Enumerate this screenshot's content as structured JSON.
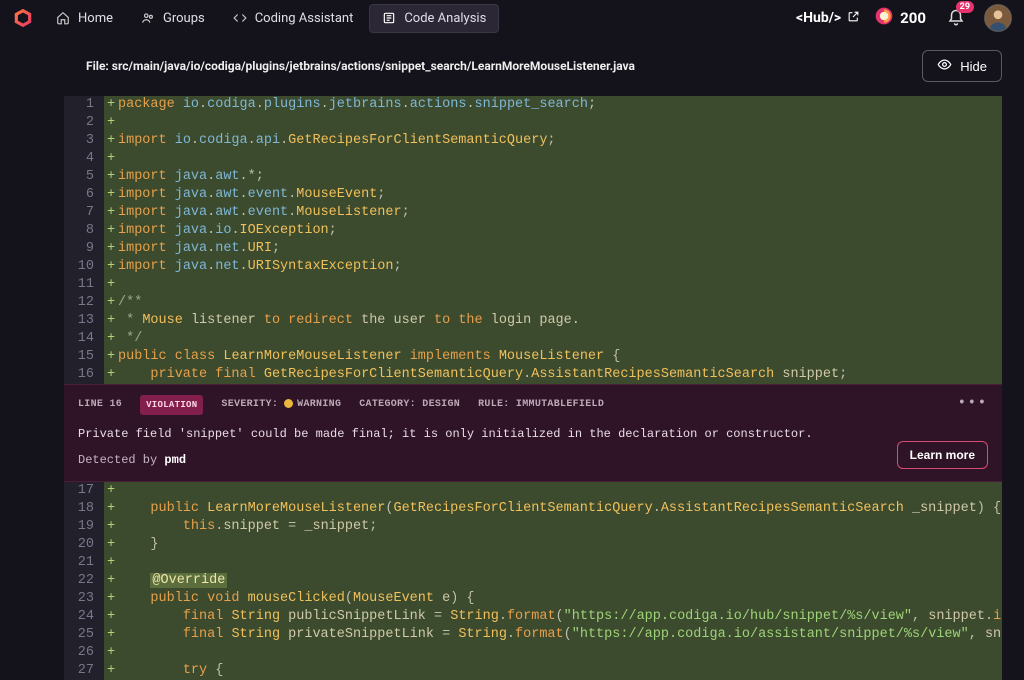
{
  "nav": {
    "home": "Home",
    "groups": "Groups",
    "assistant": "Coding Assistant",
    "analysis": "Code Analysis"
  },
  "hub_label": "<Hub/>",
  "points": "200",
  "notif_count": "29",
  "file": {
    "label": "File:",
    "path": "src/main/java/io/codiga/plugins/jetbrains/actions/snippet_search/LearnMoreMouseListener.java"
  },
  "hide_label": "Hide",
  "lines_a": [
    {
      "n": "1",
      "html": "<span class=t-kw>package</span> <span class=t-pkg>io</span><span class=t-punc>.</span><span class=t-pkg>codiga</span><span class=t-punc>.</span><span class=t-pkg>plugins</span><span class=t-punc>.</span><span class=t-pkg>jetbrains</span><span class=t-punc>.</span><span class=t-pkg>actions</span><span class=t-punc>.</span><span class=t-pkg>snippet_search</span><span class=t-punc>;</span>"
    },
    {
      "n": "2",
      "html": ""
    },
    {
      "n": "3",
      "html": "<span class=t-kw>import</span> <span class=t-pkg>io</span><span class=t-punc>.</span><span class=t-pkg>codiga</span><span class=t-punc>.</span><span class=t-pkg>api</span><span class=t-punc>.</span><span class=t-cls>GetRecipesForClientSemanticQuery</span><span class=t-punc>;</span>"
    },
    {
      "n": "4",
      "html": ""
    },
    {
      "n": "5",
      "html": "<span class=t-kw>import</span> <span class=t-pkg>java</span><span class=t-punc>.</span><span class=t-pkg>awt</span><span class=t-punc>.*;</span>"
    },
    {
      "n": "6",
      "html": "<span class=t-kw>import</span> <span class=t-pkg>java</span><span class=t-punc>.</span><span class=t-pkg>awt</span><span class=t-punc>.</span><span class=t-pkg>event</span><span class=t-punc>.</span><span class=t-cls>MouseEvent</span><span class=t-punc>;</span>"
    },
    {
      "n": "7",
      "html": "<span class=t-kw>import</span> <span class=t-pkg>java</span><span class=t-punc>.</span><span class=t-pkg>awt</span><span class=t-punc>.</span><span class=t-pkg>event</span><span class=t-punc>.</span><span class=t-cls>MouseListener</span><span class=t-punc>;</span>"
    },
    {
      "n": "8",
      "html": "<span class=t-kw>import</span> <span class=t-pkg>java</span><span class=t-punc>.</span><span class=t-pkg>io</span><span class=t-punc>.</span><span class=t-cls>IOException</span><span class=t-punc>;</span>"
    },
    {
      "n": "9",
      "html": "<span class=t-kw>import</span> <span class=t-pkg>java</span><span class=t-punc>.</span><span class=t-pkg>net</span><span class=t-punc>.</span><span class=t-cls>URI</span><span class=t-punc>;</span>"
    },
    {
      "n": "10",
      "html": "<span class=t-kw>import</span> <span class=t-pkg>java</span><span class=t-punc>.</span><span class=t-pkg>net</span><span class=t-punc>.</span><span class=t-cls>URISyntaxException</span><span class=t-punc>;</span>"
    },
    {
      "n": "11",
      "html": ""
    },
    {
      "n": "12",
      "html": "<span class=t-com>/**</span>"
    },
    {
      "n": "13",
      "html": "<span class=t-com> *</span> <span class=t-cls>Mouse</span> <span class=t-id>listener</span> <span class=t-kw>to</span> <span class=t-kw>redirect</span> <span class=t-id>the user</span> <span class=t-kw>to</span> <span class=t-kw>the</span> <span class=t-id>login page.</span>"
    },
    {
      "n": "14",
      "html": "<span class=t-com> */</span>"
    },
    {
      "n": "15",
      "html": "<span class=t-kw>public</span> <span class=t-kw>class</span> <span class=t-cls>LearnMoreMouseListener</span> <span class=t-kw>implements</span> <span class=t-cls>MouseListener</span> <span class=t-punc>{</span>"
    },
    {
      "n": "16",
      "html": "    <span class=t-kw>private</span> <span class=t-kw>final</span> <span class=t-cls>GetRecipesForClientSemanticQuery</span><span class=t-punc>.</span><span class=t-cls>AssistantRecipesSemanticSearch</span> <span class=t-id>snippet</span><span class=t-punc>;</span>"
    }
  ],
  "violation": {
    "line_label": "LINE 16",
    "pill": "VIOLATION",
    "severity_label": "SEVERITY:",
    "severity_value": "WARNING",
    "category_label": "CATEGORY:",
    "category_value": "DESIGN",
    "rule_label": "RULE:",
    "rule_value": "IMMUTABLEFIELD",
    "message": "Private field 'snippet' could be made final; it is only initialized in the declaration or constructor.",
    "detected_prefix": "Detected by ",
    "detected_tool": "pmd",
    "learn_more": "Learn more",
    "more": "•••"
  },
  "lines_b": [
    {
      "n": "17",
      "html": ""
    },
    {
      "n": "18",
      "html": "    <span class=t-kw>public</span> <span class=t-cls>LearnMoreMouseListener</span><span class=t-punc>(</span><span class=t-cls>GetRecipesForClientSemanticQuery</span><span class=t-punc>.</span><span class=t-cls>AssistantRecipesSemanticSearch</span> <span class=t-id>_snippet</span><span class=t-punc>) {</span>"
    },
    {
      "n": "19",
      "html": "        <span class=t-kw>this</span><span class=t-punc>.</span><span class=t-id>snippet</span> <span class=t-punc>=</span> <span class=t-id>_snippet</span><span class=t-punc>;</span>"
    },
    {
      "n": "20",
      "html": "    <span class=t-punc>}</span>"
    },
    {
      "n": "21",
      "html": ""
    },
    {
      "n": "22",
      "html": "    <span class=t-ann>@Override</span>"
    },
    {
      "n": "23",
      "html": "    <span class=t-kw>public</span> <span class=t-kw>void</span> <span class=t-cls>mouseClicked</span><span class=t-punc>(</span><span class=t-cls>MouseEvent</span> <span class=t-id>e</span><span class=t-punc>) {</span>"
    },
    {
      "n": "24",
      "html": "        <span class=t-kw>final</span> <span class=t-cls>String</span> <span class=t-id>publicSnippetLink</span> <span class=t-punc>=</span> <span class=t-cls>String</span><span class=t-punc>.</span><span class=t-kw>format</span><span class=t-punc>(</span><span class=t-str>\"https://app.codiga.io/hub/snippet/%s/view\"</span><span class=t-punc>,</span> <span class=t-id>snippet</span><span class=t-punc>.</span><span class=t-kw>id</span><span class=t-punc>());</span>"
    },
    {
      "n": "25",
      "html": "        <span class=t-kw>final</span> <span class=t-cls>String</span> <span class=t-id>privateSnippetLink</span> <span class=t-punc>=</span> <span class=t-cls>String</span><span class=t-punc>.</span><span class=t-kw>format</span><span class=t-punc>(</span><span class=t-str>\"https://app.codiga.io/assistant/snippet/%s/view\"</span><span class=t-punc>,</span> <span class=t-id>snippet</span><span class=t-punc>.i</span>"
    },
    {
      "n": "26",
      "html": ""
    },
    {
      "n": "27",
      "html": "        <span class=t-kw>try</span> <span class=t-punc>{</span>"
    }
  ]
}
